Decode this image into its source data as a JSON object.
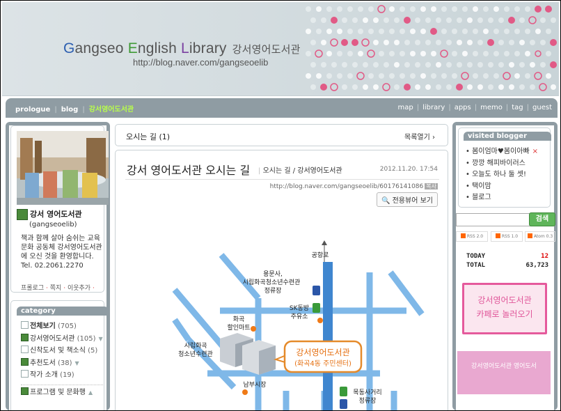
{
  "header": {
    "title_g": "G",
    "title_1": "angseo ",
    "title_e": "E",
    "title_2": "nglish ",
    "title_l": "L",
    "title_3": "ibrary",
    "title_kr": "강서영어도서관",
    "url": "http://blog.naver.com/gangseoelib"
  },
  "nav": {
    "left": [
      "prologue",
      "blog",
      "강서영어도서관"
    ],
    "right": [
      "map",
      "library",
      "apps",
      "memo",
      "tag",
      "guest"
    ]
  },
  "profile": {
    "name": "강서 영어도서관",
    "id": "(gangseoelib)",
    "desc": "책과 함께 살아 숨쉬는 교육 문화 공동체 강서영어도서관에 오신 것을 환영합니다.",
    "tel": "Tel. 02.2061.2270",
    "links": [
      "프롤로그",
      "쪽지",
      "이웃추가"
    ]
  },
  "category": {
    "title": "category",
    "items": [
      {
        "label": "전체보기",
        "count": "(705)"
      },
      {
        "label": "강서영어도서관",
        "count": "(105)"
      },
      {
        "label": "신착도서 및 책소식",
        "count": "(5)"
      },
      {
        "label": "추천도서",
        "count": "(38)"
      },
      {
        "label": "작가 소개",
        "count": "(19)"
      },
      {
        "label": "프로그램 및 문화행",
        "count": ""
      }
    ]
  },
  "route": {
    "title": "오시는 길",
    "count": "(1)",
    "list_toggle": "목록열기"
  },
  "post": {
    "title": "강서 영어도서관 오시는 길",
    "category": "오시는 길 / 강서영어도서관",
    "date": "2012.11.20. 17:54",
    "url": "http://blog.naver.com/gangseoelib/60176141086",
    "copy": "복사",
    "view_button": "전용뷰어 보기"
  },
  "map_labels": {
    "gonghang": "공항로",
    "yongmun": "용문사,",
    "youth1": "시립화곡청소년수련관",
    "stop1": "정류장",
    "sk1": "SK동방",
    "sk2": "주유소",
    "hwagok1": "화곡",
    "hwagok2": "할인마트",
    "youth2a": "시립화곡",
    "youth2b": "청소년수련관",
    "lib1": "강서영어도서관",
    "lib2": "(화곡4동 주민센터)",
    "nambu": "남부시장",
    "mokdong1": "목동사거리",
    "mokdong2": "정류장"
  },
  "visited": {
    "title": "visited blogger",
    "items": [
      "봄이엄마♥봄이아빠",
      "깡깡 해피바이러스",
      "오늘도 하나 둘 셋!",
      "택이맘",
      "블로그"
    ]
  },
  "search": {
    "button": "검색",
    "placeholder": ""
  },
  "rss": [
    "RSS 2.0",
    "RSS 1.0",
    "Atom 0.3"
  ],
  "stats": {
    "today_label": "TODAY",
    "today": "12",
    "total_label": "TOTAL",
    "total": "63,723"
  },
  "banner1": {
    "line1": "강서영어도서관",
    "line2": "카페로 놀러오기"
  },
  "banner2": {
    "text": "강서영어도서관 영어도서"
  },
  "colors": {
    "nav_bg": "#8f9ca3",
    "active_nav": "#b8ff4a",
    "search_btn": "#5fb55a",
    "pink": "#e55a9c"
  }
}
